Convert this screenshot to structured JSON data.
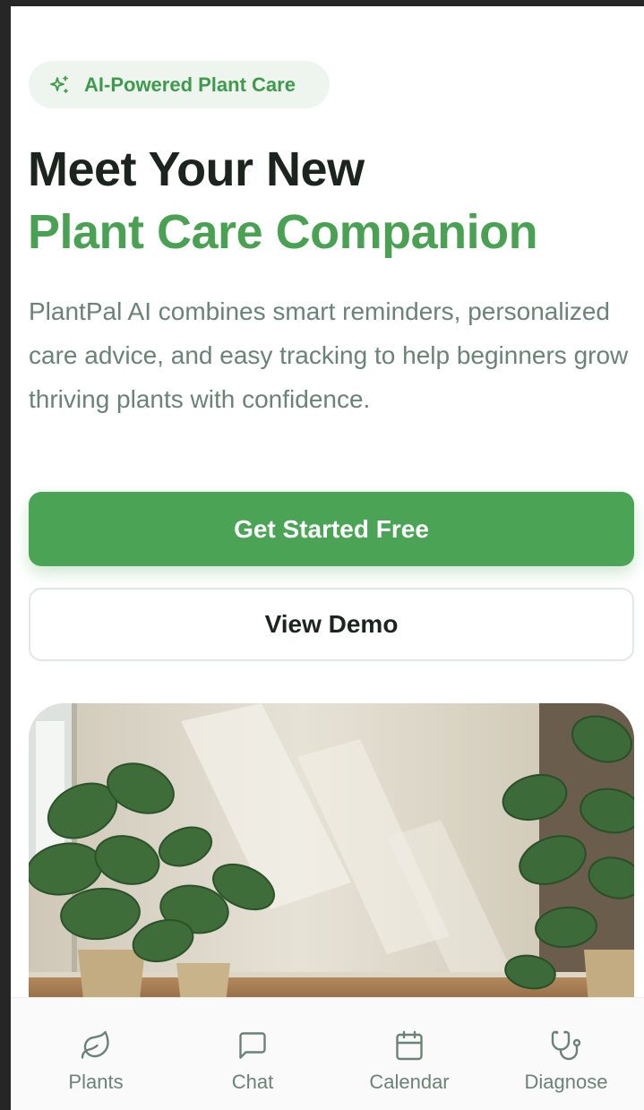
{
  "badge": {
    "label": "AI-Powered Plant Care",
    "icon": "sparkle-icon"
  },
  "hero": {
    "title_line1": "Meet Your New",
    "title_line2": "Plant Care Companion",
    "description": "PlantPal AI combines smart reminders, personalized care advice, and easy tracking to help beginners grow thriving plants with confidence."
  },
  "actions": {
    "primary_label": "Get Started Free",
    "secondary_label": "View Demo"
  },
  "image": {
    "subject": "monstera-plants-photo"
  },
  "nav": {
    "items": [
      {
        "label": "Plants",
        "icon": "leaf-icon"
      },
      {
        "label": "Chat",
        "icon": "chat-bubble-icon"
      },
      {
        "label": "Calendar",
        "icon": "calendar-icon"
      },
      {
        "label": "Diagnose",
        "icon": "stethoscope-icon"
      }
    ]
  },
  "colors": {
    "brand_green": "#4ba356",
    "title_dark": "#1c2420",
    "muted_text": "#6b8278",
    "badge_bg": "#edf5ee"
  }
}
